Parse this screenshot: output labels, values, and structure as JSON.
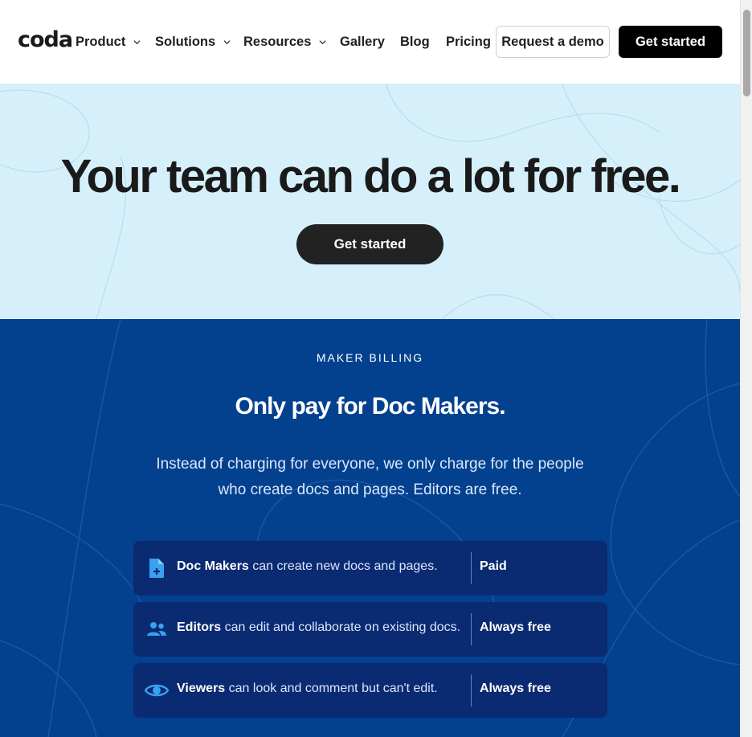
{
  "header": {
    "logo": "coda",
    "nav": [
      {
        "label": "Product",
        "dropdown": true
      },
      {
        "label": "Solutions",
        "dropdown": true
      },
      {
        "label": "Resources",
        "dropdown": true
      },
      {
        "label": "Gallery",
        "dropdown": false
      },
      {
        "label": "Blog",
        "dropdown": false
      },
      {
        "label": "Pricing",
        "dropdown": false
      }
    ],
    "demo_label": "Request a demo",
    "start_label": "Get started"
  },
  "hero": {
    "title": "Your team can do a lot for free.",
    "button_label": "Get started"
  },
  "billing": {
    "eyebrow": "MAKER BILLING",
    "title": "Only pay for Doc Makers.",
    "description": "Instead of charging for everyone, we only charge for the people who create docs and pages. Editors are free.",
    "rows": [
      {
        "icon": "doc-plus-icon",
        "role": "Doc Makers",
        "text": " can create new docs and pages.",
        "price": "Paid"
      },
      {
        "icon": "people-icon",
        "role": "Editors",
        "text": " can edit and collaborate on existing docs.",
        "price": "Always free"
      },
      {
        "icon": "eye-icon",
        "role": "Viewers",
        "text": " can look and comment but can't edit.",
        "price": "Always free"
      }
    ]
  },
  "colors": {
    "hero_bg": "#d6f0fb",
    "billing_bg": "#03418f",
    "row_bg": "#0a2a72",
    "icon_blue": "#3aa0f0"
  }
}
